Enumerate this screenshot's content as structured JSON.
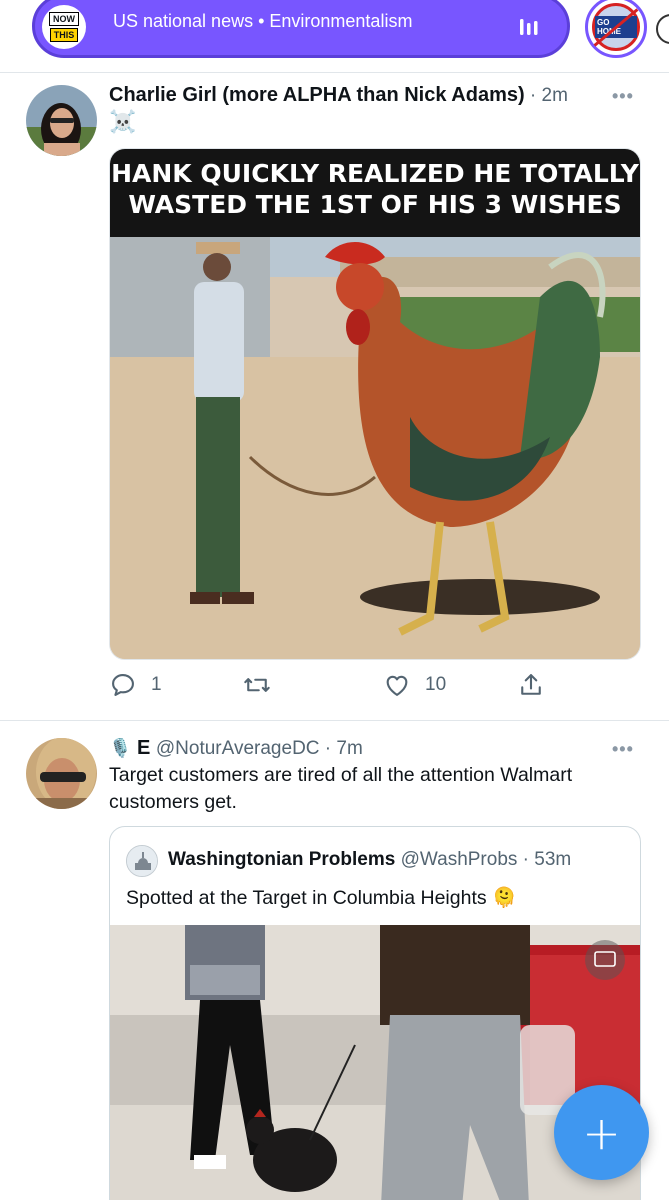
{
  "spaces": {
    "logo_top": "NOW",
    "logo_bottom": "THIS",
    "title": "US national news • Environmentalism",
    "right_avatar_label": "GO HOME"
  },
  "tweets": [
    {
      "author": "Charlie Girl (more ALPHA than Nick Adams)",
      "time": "2m",
      "emoji": "☠️",
      "image_caption_line1": "HANK QUICKLY REALIZED HE TOTALLY",
      "image_caption_line2": "WASTED THE 1ST OF HIS  3 WISHES",
      "replies": "1",
      "retweets": "",
      "likes": "10"
    },
    {
      "author_prefix": "🎙️",
      "author": "E",
      "handle": "@NoturAverageDC",
      "time": "7m",
      "text": "Target customers are tired of all the attention Walmart customers get.",
      "quote": {
        "author": "Washingtonian Problems",
        "handle": "@WashProbs",
        "time": "53m",
        "text": "Spotted at the Target in Columbia Heights 🫠"
      }
    }
  ],
  "colors": {
    "spaces_purple": "#7856ff",
    "fab_blue": "#3f97f0",
    "secondary_text": "#536471"
  }
}
